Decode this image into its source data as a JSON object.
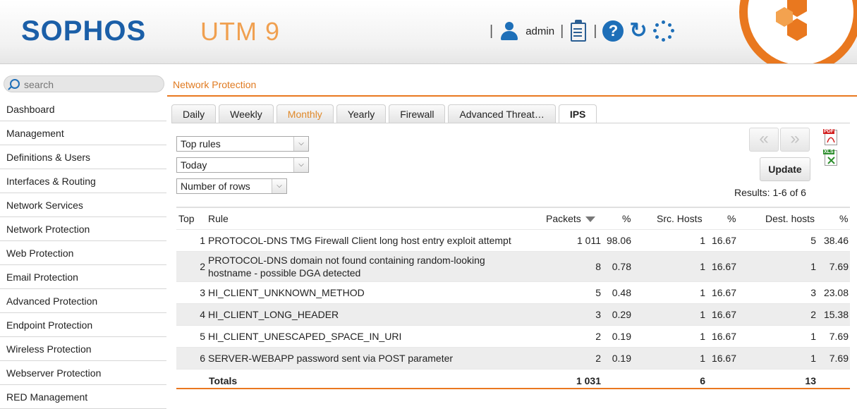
{
  "header": {
    "logo": "SOPHOS",
    "product": "UTM 9",
    "user": "admin",
    "separator": "|",
    "help_glyph": "?",
    "reload_glyph": "↻"
  },
  "search": {
    "placeholder": "search"
  },
  "sidebar": {
    "items": [
      {
        "label": "Dashboard"
      },
      {
        "label": "Management"
      },
      {
        "label": "Definitions & Users"
      },
      {
        "label": "Interfaces & Routing"
      },
      {
        "label": "Network Services"
      },
      {
        "label": "Network Protection"
      },
      {
        "label": "Web Protection"
      },
      {
        "label": "Email Protection"
      },
      {
        "label": "Advanced Protection"
      },
      {
        "label": "Endpoint Protection"
      },
      {
        "label": "Wireless Protection"
      },
      {
        "label": "Webserver Protection"
      },
      {
        "label": "RED Management"
      }
    ]
  },
  "breadcrumb": "Network Protection",
  "tabs": [
    {
      "label": "Daily"
    },
    {
      "label": "Weekly"
    },
    {
      "label": "Monthly"
    },
    {
      "label": "Yearly"
    },
    {
      "label": "Firewall"
    },
    {
      "label": "Advanced Threat…"
    },
    {
      "label": "IPS"
    }
  ],
  "filters": {
    "report": "Top rules",
    "period": "Today",
    "rows": "Number of rows"
  },
  "pager": {
    "prev": "«",
    "next": "»"
  },
  "export": {
    "pdf": "PDF",
    "xls": "XLS"
  },
  "update_label": "Update",
  "results": "Results: 1-6 of 6",
  "table": {
    "headers": {
      "top": "Top",
      "rule": "Rule",
      "packets": "Packets",
      "packets_pct": "%",
      "src": "Src. Hosts",
      "src_pct": "%",
      "dst": "Dest. hosts",
      "dst_pct": "%"
    },
    "rows": [
      {
        "top": "1",
        "rule1": "PROTOCOL-DNS TMG Firewall Client long host entry exploit attempt",
        "rule2": "",
        "packets": "1 011",
        "packets_pct": "98.06",
        "src": "1",
        "src_pct": "16.67",
        "dst": "5",
        "dst_pct": "38.46"
      },
      {
        "top": "2",
        "rule1": "PROTOCOL-DNS domain not found containing random-looking",
        "rule2": "hostname - possible DGA detected",
        "packets": "8",
        "packets_pct": "0.78",
        "src": "1",
        "src_pct": "16.67",
        "dst": "1",
        "dst_pct": "7.69"
      },
      {
        "top": "3",
        "rule1": "HI_CLIENT_UNKNOWN_METHOD",
        "rule2": "",
        "packets": "5",
        "packets_pct": "0.48",
        "src": "1",
        "src_pct": "16.67",
        "dst": "3",
        "dst_pct": "23.08"
      },
      {
        "top": "4",
        "rule1": "HI_CLIENT_LONG_HEADER",
        "rule2": "",
        "packets": "3",
        "packets_pct": "0.29",
        "src": "1",
        "src_pct": "16.67",
        "dst": "2",
        "dst_pct": "15.38"
      },
      {
        "top": "5",
        "rule1": "HI_CLIENT_UNESCAPED_SPACE_IN_URI",
        "rule2": "",
        "packets": "2",
        "packets_pct": "0.19",
        "src": "1",
        "src_pct": "16.67",
        "dst": "1",
        "dst_pct": "7.69"
      },
      {
        "top": "6",
        "rule1": "SERVER-WEBAPP password sent via POST parameter",
        "rule2": "",
        "packets": "2",
        "packets_pct": "0.19",
        "src": "1",
        "src_pct": "16.67",
        "dst": "1",
        "dst_pct": "7.69"
      }
    ],
    "totals": {
      "label": "Totals",
      "packets": "1 031",
      "src": "6",
      "dst": "13"
    }
  }
}
